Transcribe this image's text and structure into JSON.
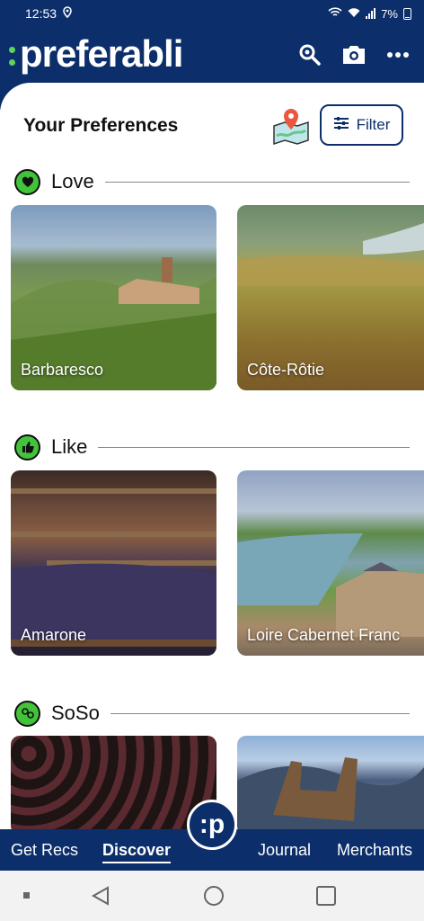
{
  "status_bar": {
    "time": "12:53",
    "battery": "7%"
  },
  "header": {
    "logo": "preferabli"
  },
  "preferences": {
    "title": "Your Preferences",
    "filter_label": "Filter"
  },
  "sections": [
    {
      "label": "Love",
      "cards": [
        "Barbaresco",
        "Côte-Rôtie"
      ]
    },
    {
      "label": "Like",
      "cards": [
        "Amarone",
        "Loire Cabernet Franc"
      ]
    },
    {
      "label": "SoSo",
      "cards": [
        "",
        ""
      ]
    }
  ],
  "nav": {
    "items": [
      "Get Recs",
      "Discover",
      "Journal",
      "Merchants"
    ],
    "active": "Discover",
    "center_logo": ":p"
  },
  "colors": {
    "brand": "#0c2f6b",
    "accent": "#41c33a"
  }
}
